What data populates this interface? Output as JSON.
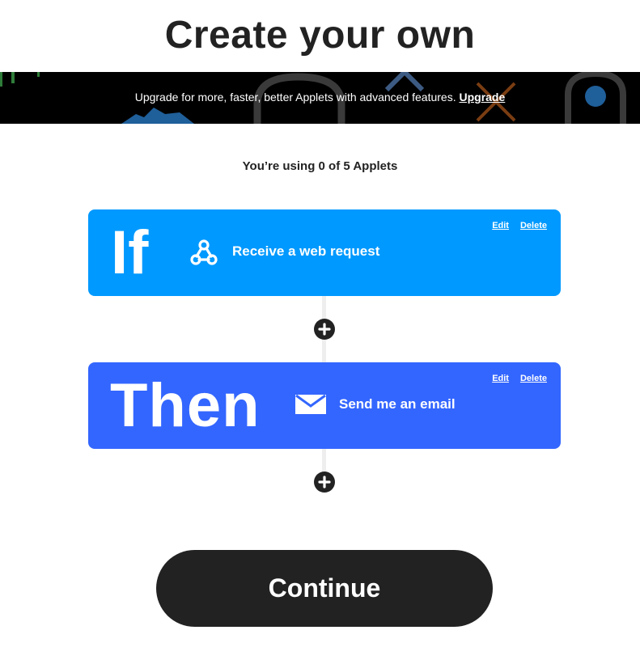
{
  "page": {
    "title": "Create your own"
  },
  "banner": {
    "text": "Upgrade for more, faster, better Applets with advanced features.",
    "link_label": "Upgrade"
  },
  "usage": {
    "text": "You’re using 0 of 5 Applets"
  },
  "trigger": {
    "keyword": "If",
    "icon": "webhook-icon",
    "label": "Receive a web request",
    "edit_label": "Edit",
    "delete_label": "Delete",
    "color": "#0099ff"
  },
  "action": {
    "keyword": "Then",
    "icon": "email-icon",
    "label": "Send me an email",
    "edit_label": "Edit",
    "delete_label": "Delete",
    "color": "#3366ff"
  },
  "continue": {
    "label": "Continue"
  },
  "colors": {
    "text": "#222222",
    "banner_background": "#000000",
    "button_background": "#222222"
  }
}
